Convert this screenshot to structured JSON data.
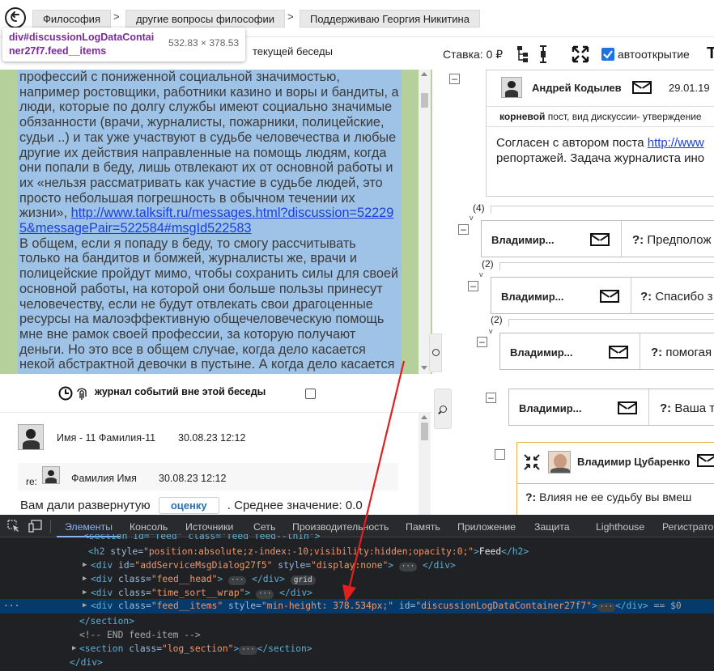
{
  "breadcrumb": {
    "items": [
      "Философия",
      "другие вопросы философии",
      "Поддерживаю Георгия Никитина"
    ],
    "separator": ">"
  },
  "tooltip": {
    "selector": "div#discussionLogDataContainer27f7.feed__items",
    "size": "532.83 × 378.53"
  },
  "toolbar": {
    "behind_tooltip_text": "текущей беседы",
    "stake_label": "Ставка: 0 ₽",
    "autoopen_label": "автооткрытие",
    "autoopen_checked": true,
    "clipped_glyph": "Т"
  },
  "feed": {
    "para1": "профессий с пониженной социальной значимостью, например ростовщики, работники казино и воры и бандиты, а люди, которые по долгу службы имеют социально значимые обязанности (врачи, журналисты, пожарники, полицейские, судьи ..) и так уже участвуют в судьбе человечества и любые другие их действия направленные на помощь людям, когда они попали в беду, лишь отвлекают их от основной работы и их «нельзя рассматривать как участие в судьбе людей, это просто небольшая погрешность в обычном течении их жизни»,",
    "link": "http://www.talksift.ru/messages.html?discussion=522295&messagePair=522584#msgId522583",
    "para2": "В общем, если я попаду в беду, то смогу рассчитывать только на бандитов и бомжей, журналисты же, врачи и полицейские пройдут мимо, чтобы сохранить силы для своей основной работы, на которой они больше пользы принесут человечеству, если не будут отвлекать свои драгоценные ресурсы на малоэффективную общечеловеческую помощь мне вне рамок своей профессии, за которую получают деньги. Но это все в общем случае, когда дело касается некой абстрактной девочки в пустыне. А когда дело касается лично вас, то тот же стакан воды - «да, это участие в судьбе», когда"
  },
  "event_log": {
    "label": "журнал событий вне этой беседы",
    "checked": false
  },
  "messages": [
    {
      "author": "Имя - 11 Фамилия-11",
      "date": "30.08.23 12:12"
    },
    {
      "prefix": "re:",
      "author": "Фамилия Имя",
      "date": "30.08.23 12:12"
    }
  ],
  "rating": {
    "text_before": "Вам дали развернутую",
    "button": "оценку",
    "text_after": ". Среднее значение: 0.0"
  },
  "tree": {
    "root": {
      "author": "Андрей Кодылев",
      "date": "29.01.19",
      "date_tail": "(",
      "meta_bold": "корневой",
      "meta_text": "пост, вид дискуссии- утверждение",
      "body_text": "Согласен с автором поста ",
      "body_link": "http://www",
      "body_line2": "репортажей. Задача журналиста ино"
    },
    "nodes": [
      {
        "count": "(4)",
        "author": "Владимир...",
        "q": "?:",
        "preview": "Предполож"
      },
      {
        "count": "(2)",
        "author": "Владимир...",
        "q": "?:",
        "preview": "Спасибо з"
      },
      {
        "count": "(2)",
        "author": "Владимир...",
        "q": "?:",
        "preview": "помогая"
      },
      {
        "count": "",
        "author": "Владимир...",
        "q": "?:",
        "preview": "Ваша т"
      }
    ],
    "last": {
      "author": "Владимир Цубаренко",
      "q": "?:",
      "preview": "Влияя не ее судьбу вы вмеш"
    }
  },
  "devtools": {
    "tabs": [
      "Элементы",
      "Консоль",
      "Источники",
      "Сеть",
      "Производительность",
      "Память",
      "Приложение",
      "Защита",
      "Lighthouse",
      "Регистратор"
    ],
    "active_tab": "Элементы",
    "lines": [
      {
        "t1": "<section id=\"feed\" class=\"feed feed--thin\">"
      },
      {
        "t1": "<h2 ",
        "a1": "style=",
        "v1": "\"position:absolute;z-index:-10;visibility:hidden;opacity:0;\"",
        "t2": ">",
        "text": "Feed",
        "t3": "</h2>"
      },
      {
        "t1": "<div ",
        "a1": "id=",
        "v1": "\"addServiceMsgDialog27f5\"",
        "a2": " style=",
        "v2": "\"display:none\"",
        "t2": ">",
        "t3": "</div>"
      },
      {
        "t1": "<div ",
        "a1": "class=",
        "v1": "\"feed__head\"",
        "t2": ">",
        "t3": "</div>",
        "badge": "grid"
      },
      {
        "t1": "<div ",
        "a1": "class=",
        "v1": "\"time_sort__wrap\"",
        "t2": ">",
        "t3": "</div>"
      },
      {
        "t1": "<div ",
        "a1": "class=",
        "v1": "\"feed__items\"",
        "a2": " style=",
        "v2": "\"min-height: 378.534px;\"",
        "a3": " id=",
        "v3": "\"discussionLogDataContainer27f7\"",
        "t2": ">",
        "t3": "</div>",
        "eq": " == $0"
      },
      {
        "t1": "</section>"
      },
      {
        "t1": "<!-- END feed-item -->"
      },
      {
        "t1": "<section ",
        "a1": "class=",
        "v1": "\"log_section\"",
        "t2": ">",
        "t3": "</section>"
      },
      {
        "t1": "</div>"
      }
    ]
  },
  "colors": {
    "selection": "#9ec3e6",
    "padding_highlight": "#b5d09a",
    "devtools_bg": "#202124",
    "selected_line": "#063a6b",
    "arrow": "#e02020",
    "link": "#1a3fe0"
  },
  "icons": [
    "back-arrow-icon",
    "equalizer-icon",
    "tree-icon",
    "vertical-dots-icon",
    "expand-arrows-icon",
    "clock-icon",
    "fingerprint-icon",
    "mail-icon",
    "search-icon",
    "compress-icon",
    "inspect-cursor-icon",
    "device-toggle-icon"
  ]
}
